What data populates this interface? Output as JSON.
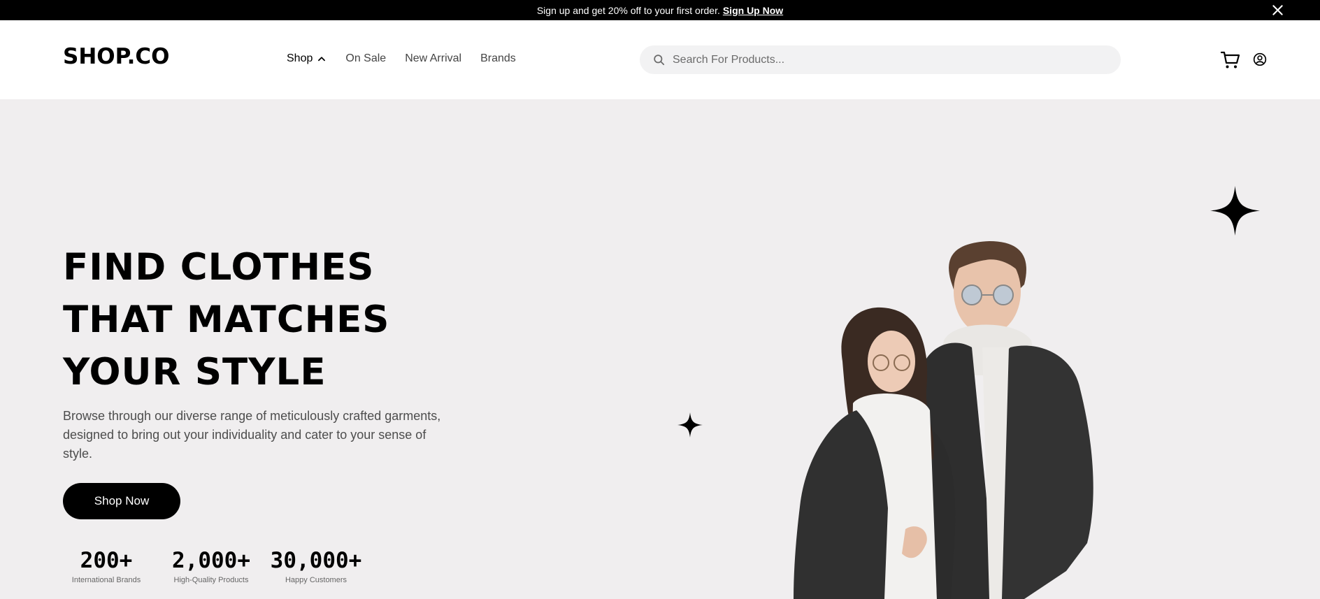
{
  "promo": {
    "text": "Sign up and get 20% off to your first order.",
    "link": "Sign Up Now",
    "close_icon": "close-icon"
  },
  "header": {
    "logo": "SHOP.CO",
    "nav": [
      {
        "label": "Shop",
        "icon": "chevron-up-icon"
      },
      {
        "label": "On Sale"
      },
      {
        "label": "New Arrival"
      },
      {
        "label": "Brands"
      }
    ],
    "search": {
      "placeholder": "Search For Products...",
      "value": "",
      "icon": "search-icon"
    },
    "cart_icon": "cart-icon",
    "account_icon": "account-icon"
  },
  "hero": {
    "headline": [
      "FIND CLOTHES",
      "THAT MATCHES",
      "YOUR STYLE"
    ],
    "description": "Browse through our diverse range of meticulously crafted garments, designed to bring out your individuality and cater to your sense of style.",
    "cta": "Shop Now",
    "stats": [
      {
        "value": "200+",
        "label": "International Brands"
      },
      {
        "value": "2,000+",
        "label": "High-Quality Products"
      },
      {
        "value": "30,000+",
        "label": "Happy Customers"
      }
    ]
  },
  "colors": {
    "dark": "#000000",
    "hero_bg": "#f0eeef",
    "search_bg": "#f2f2f3",
    "muted_text": "#4d4d4d"
  }
}
